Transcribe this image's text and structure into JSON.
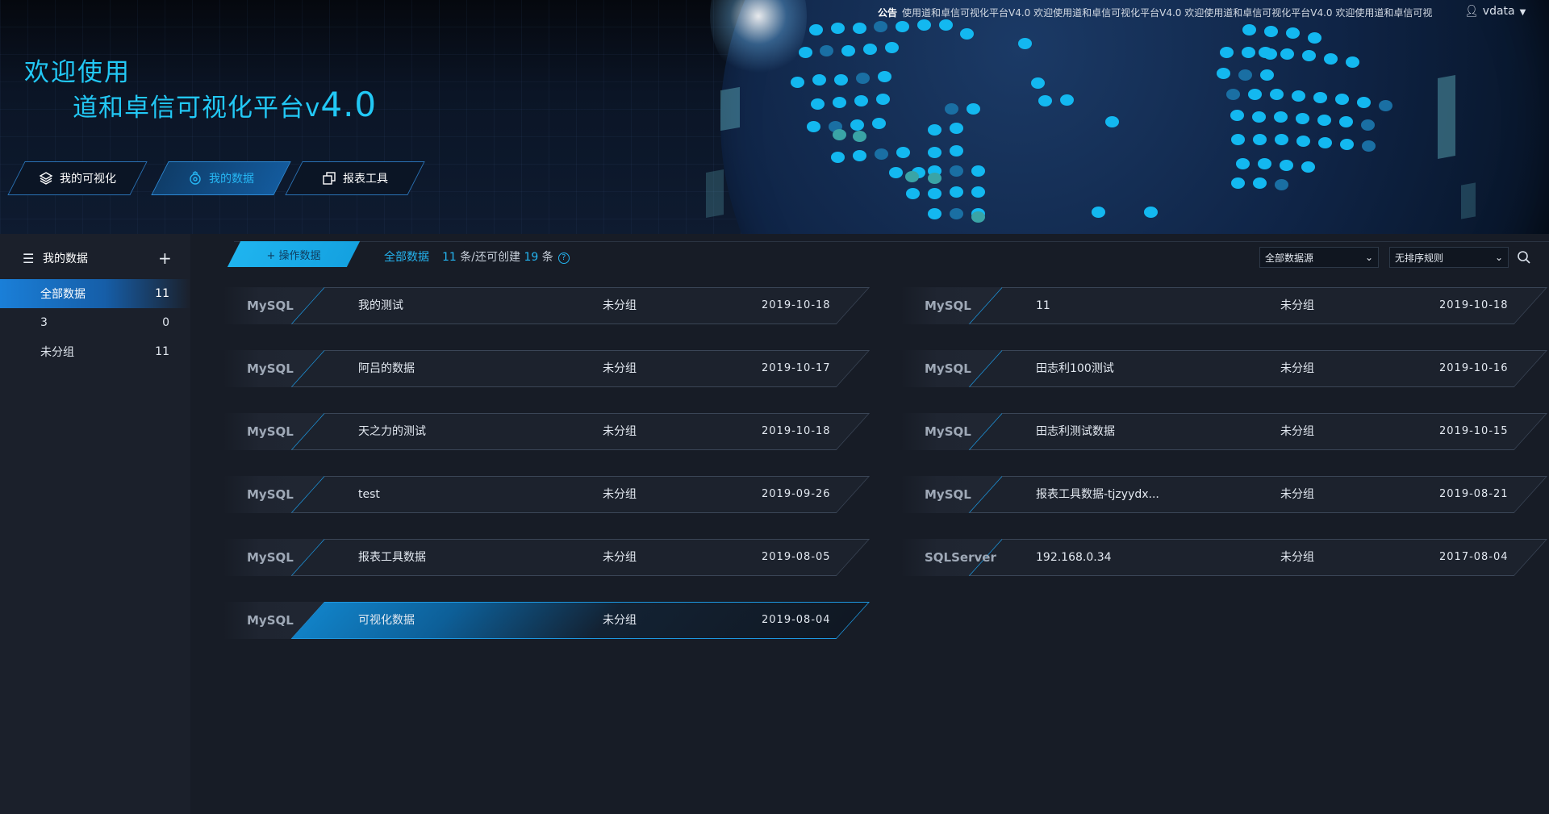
{
  "header": {
    "title_line1": "欢迎使用",
    "title_line2": "道和卓信可视化平台v",
    "title_version": "4.0",
    "notice_label": "公告",
    "notice_text": "使用道和卓信可视化平台V4.0   欢迎使用道和卓信可视化平台V4.0   欢迎使用道和卓信可视化平台V4.0   欢迎使用道和卓信可视",
    "user": "vdata"
  },
  "nav": {
    "items": [
      {
        "label": "我的可视化",
        "icon": "layers-icon"
      },
      {
        "label": "我的数据",
        "icon": "database-icon"
      },
      {
        "label": "报表工具",
        "icon": "copy-icon"
      }
    ],
    "active_index": 1
  },
  "sidebar": {
    "title": "我的数据",
    "groups": [
      {
        "label": "全部数据",
        "count": "11"
      },
      {
        "label": "3",
        "count": "0"
      },
      {
        "label": "未分组",
        "count": "11"
      }
    ],
    "active_index": 0
  },
  "toolbar": {
    "operate_label": "+ 操作数据",
    "all_label": "全部数据",
    "count": "11",
    "count_suffix": "条/还可创建",
    "remaining": "19",
    "remaining_suffix": "条",
    "source_select": "全部数据源",
    "sort_select": "无排序规则"
  },
  "cards": [
    {
      "db": "MySQL",
      "name": "我的测试",
      "group": "未分组",
      "date": "2019-10-18"
    },
    {
      "db": "MySQL",
      "name": "11",
      "group": "未分组",
      "date": "2019-10-18"
    },
    {
      "db": "MySQL",
      "name": "阿吕的数据",
      "group": "未分组",
      "date": "2019-10-17"
    },
    {
      "db": "MySQL",
      "name": "田志利100测试",
      "group": "未分组",
      "date": "2019-10-16"
    },
    {
      "db": "MySQL",
      "name": "天之力的测试",
      "group": "未分组",
      "date": "2019-10-18"
    },
    {
      "db": "MySQL",
      "name": "田志利测试数据",
      "group": "未分组",
      "date": "2019-10-15"
    },
    {
      "db": "MySQL",
      "name": "test",
      "group": "未分组",
      "date": "2019-09-26"
    },
    {
      "db": "MySQL",
      "name": "报表工具数据-tjzyydx...",
      "group": "未分组",
      "date": "2019-08-21"
    },
    {
      "db": "MySQL",
      "name": "报表工具数据",
      "group": "未分组",
      "date": "2019-08-05"
    },
    {
      "db": "SQLServer",
      "name": "192.168.0.34",
      "group": "未分组",
      "date": "2017-08-04"
    },
    {
      "db": "MySQL",
      "name": "可视化数据",
      "group": "未分组",
      "date": "2019-08-04"
    }
  ],
  "selected_card_index": 10,
  "colors": {
    "accent": "#24b4f0",
    "background": "#171c26"
  }
}
